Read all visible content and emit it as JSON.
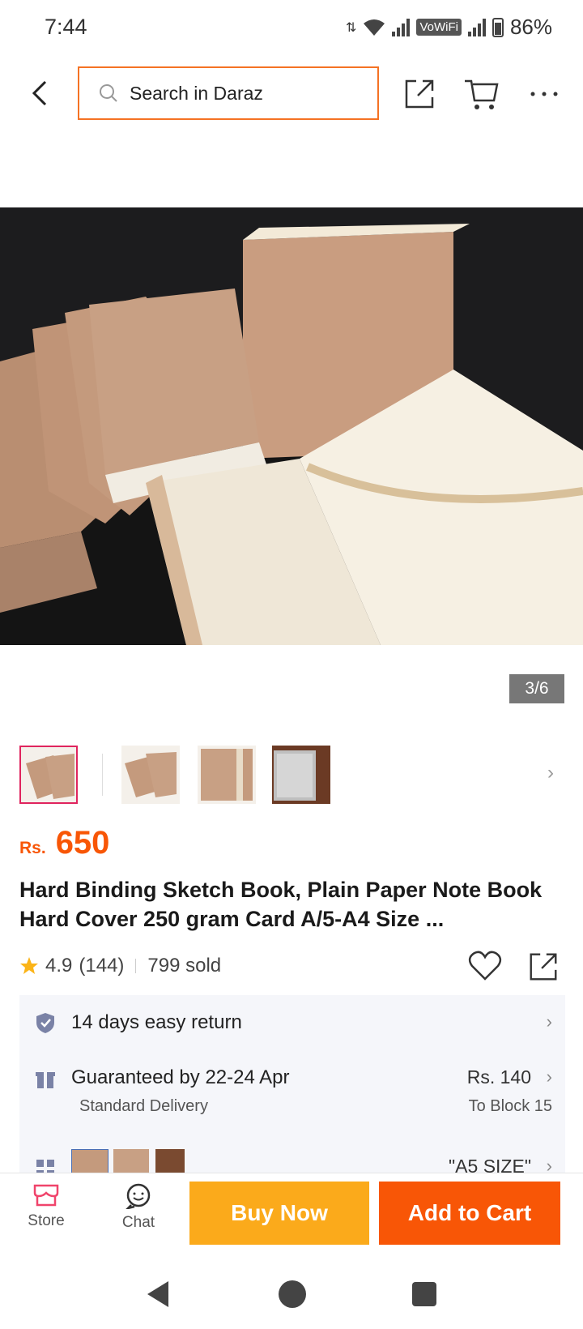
{
  "status": {
    "time": "7:44",
    "network": "VoWiFi",
    "battery": "86%"
  },
  "search": {
    "placeholder": "Search in Daraz"
  },
  "gallery": {
    "counter": "3/6",
    "thumbnail_count": 4
  },
  "product": {
    "currency": "Rs.",
    "price": "650",
    "title": "Hard Binding Sketch Book, Plain Paper Note Book Hard Cover 250 gram Card A/5-A4 Size ...",
    "rating": "4.9",
    "reviews": "(144)",
    "sold": "799 sold"
  },
  "info": {
    "return": "14 days easy return",
    "delivery_title": "Guaranteed by 22-24 Apr",
    "delivery_type": "Standard Delivery",
    "delivery_fee": "Rs. 140",
    "delivery_to": "To Block 15",
    "variant": "\"A5 SIZE\""
  },
  "bottom": {
    "store": "Store",
    "chat": "Chat",
    "buy_now": "Buy Now",
    "add_to_cart": "Add to Cart"
  },
  "colors": {
    "accent": "#f85606",
    "buy": "#fbaa1b",
    "cart": "#f85606"
  }
}
